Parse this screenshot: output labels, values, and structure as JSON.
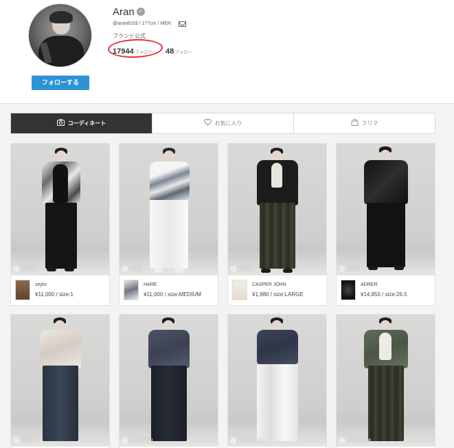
{
  "profile": {
    "name": "Aran",
    "meta": "@aran8103 / 177cm / MEN",
    "brand_label": "ブランド公式",
    "followers_count": "17944",
    "followers_label": "フォロワー",
    "following_count": "48",
    "following_label": "フォロー",
    "follow_button": "フォローする"
  },
  "tabs": [
    {
      "label": "コーディネート",
      "icon": "camera-icon",
      "active": true
    },
    {
      "label": "お気に入り",
      "icon": "heart-icon",
      "active": false
    },
    {
      "label": "フリマ",
      "icon": "bag-icon",
      "active": false
    }
  ],
  "posts": [
    {
      "timestamp": "29分前",
      "brand": "seyto",
      "price": "¥11,000 / size:1"
    },
    {
      "timestamp": "1日前",
      "brand": "HARE",
      "price": "¥11,000 / size:MEDIUM"
    },
    {
      "timestamp": "2日前",
      "brand": "CASPER JOHN",
      "price": "¥1,980 / size:LARGE"
    },
    {
      "timestamp": "4日前",
      "brand": "ADRER",
      "price": "¥14,850 / size:26.5"
    },
    {
      "timestamp": "8日前"
    },
    {
      "timestamp": "2024/08/11"
    },
    {
      "timestamp": "2024/08/10"
    },
    {
      "timestamp": "2024/08/08"
    }
  ],
  "colors": {
    "accent": "#2b93d6",
    "active_tab": "#333333",
    "highlight_circle": "#e0303a"
  }
}
